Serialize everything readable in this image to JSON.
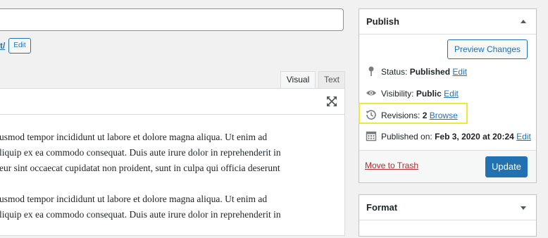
{
  "editor": {
    "permalink_tail": "t/",
    "permalink_edit_label": "Edit",
    "tabs": [
      {
        "label": "Visual"
      },
      {
        "label": "Text"
      }
    ],
    "paragraphs": [
      [
        "usmod tempor incididunt ut labore et dolore magna aliqua. Ut enim ad",
        "liquip ex ea commodo consequat. Duis aute irure dolor in reprehenderit in",
        "eur sint occaecat cupidatat non proident, sunt in culpa qui officia deserunt"
      ],
      [
        "usmod tempor incididunt ut labore et dolore magna aliqua. Ut enim ad",
        "liquip ex ea commodo consequat. Duis aute irure dolor in reprehenderit in"
      ]
    ],
    "fullscreen_icon": "expand-arrows-icon"
  },
  "publish": {
    "title": "Publish",
    "preview_label": "Preview Changes",
    "status": {
      "label": "Status:",
      "value": "Published",
      "action": "Edit",
      "icon": "pin-icon"
    },
    "visibility": {
      "label": "Visibility:",
      "value": "Public",
      "action": "Edit",
      "icon": "eye-icon"
    },
    "revisions": {
      "label": "Revisions:",
      "value": "2",
      "action": "Browse",
      "icon": "history-icon"
    },
    "published_on": {
      "label": "Published on:",
      "value": "Feb 3, 2020 at 20:24",
      "action": "Edit",
      "icon": "calendar-icon"
    },
    "trash_label": "Move to Trash",
    "update_label": "Update",
    "highlight_color": "#eaea3c"
  },
  "format": {
    "title": "Format"
  },
  "colors": {
    "accent": "#2271b1",
    "trash": "#b32d2e"
  }
}
